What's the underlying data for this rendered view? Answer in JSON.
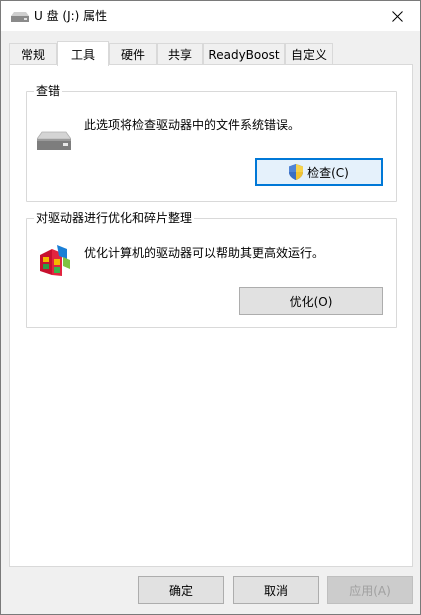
{
  "window": {
    "title": "U 盘 (J:) 属性"
  },
  "tabs": [
    {
      "label": "常规"
    },
    {
      "label": "工具"
    },
    {
      "label": "硬件"
    },
    {
      "label": "共享"
    },
    {
      "label": "ReadyBoost"
    },
    {
      "label": "自定义"
    }
  ],
  "active_tab": "工具",
  "error_checking": {
    "title": "查错",
    "description": "此选项将检查驱动器中的文件系统错误。",
    "button_label": "检查(C)",
    "icon": "drive-icon"
  },
  "optimize": {
    "title": "对驱动器进行优化和碎片整理",
    "description": "优化计算机的驱动器可以帮助其更高效运行。",
    "button_label": "优化(O)",
    "icon": "defrag-icon"
  },
  "footer": {
    "ok_label": "确定",
    "cancel_label": "取消",
    "apply_label": "应用(A)"
  },
  "colors": {
    "accent": "#0078d7",
    "button_bg": "#e1e1e1",
    "dialog_bg": "#f0f0f0"
  }
}
